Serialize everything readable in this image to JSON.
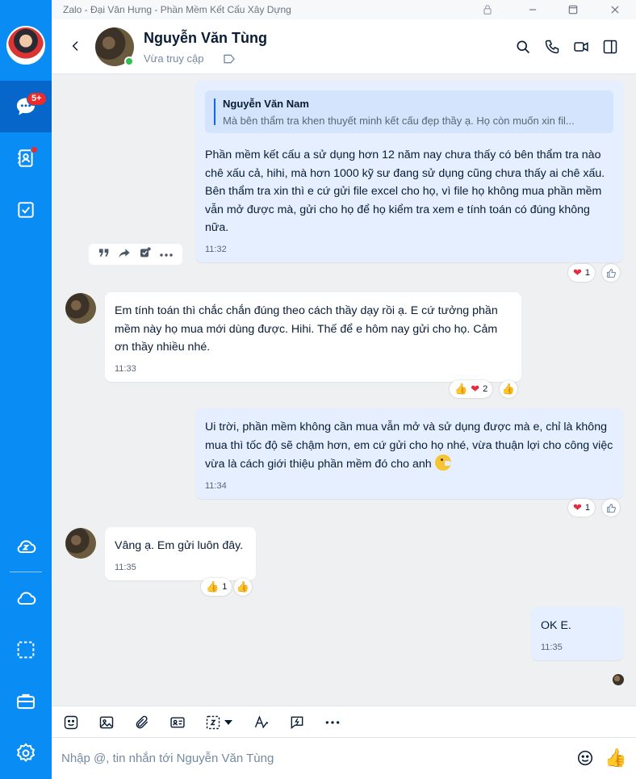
{
  "window": {
    "title": "Zalo - Đại Văn Hưng - Phần Mềm Kết Cấu Xây Dựng"
  },
  "sidebar": {
    "chat_badge": "5+",
    "items": [
      "message-icon",
      "contacts-icon",
      "todo-icon",
      "zcloud-icon",
      "cloud-icon",
      "screenshot-icon",
      "briefcase-icon",
      "settings-icon"
    ]
  },
  "header": {
    "name": "Nguyễn Văn Tùng",
    "status": "Vừa truy cập"
  },
  "messages": [
    {
      "from": "me",
      "quote_name": "Nguyễn Văn Nam",
      "quote_text": "Mà bên thẩm tra khen thuyết minh kết cấu đẹp thầy ạ. Họ còn muốn xin fil...",
      "text": "Phần mềm kết cấu a sử dụng hơn 12 năm nay chưa thấy có bên thẩm tra nào chê xấu cả, hihi, mà hơn 1000 kỹ sư đang sử dụng cũng chưa thấy ai chê xấu. Bên thẩm tra xin thì e cứ gửi file excel cho họ, vì file họ không mua phần mềm vẫn mở được mà, gửi cho họ để họ kiểm tra xem e tính toán có đúng không nữa.",
      "time": "11:32",
      "reaction_count": "1"
    },
    {
      "from": "them",
      "text": "Em tính toán thì chắc chắn đúng theo cách thầy dạy rồi ạ. E cứ tưởng phần mềm này họ mua mới dùng được. Hihi. Thế để e hôm nay gửi cho họ. Cảm ơn thầy nhiều nhé.",
      "time": "11:33",
      "reaction_count": "2"
    },
    {
      "from": "me",
      "text": "Ui trời, phần mềm không cần mua vẫn mở và sử dụng được mà e, chỉ là không mua thì tốc độ sẽ chậm hơn, em cứ gửi cho họ nhé, vừa thuận lợi cho công việc vừa là cách giới thiệu phần mềm đó cho anh",
      "time": "11:34",
      "reaction_count": "1"
    },
    {
      "from": "them",
      "text": "Vâng ạ. Em gửi luôn đây.",
      "time": "11:35",
      "reaction_count": "1"
    },
    {
      "from": "me",
      "text": "OK E.",
      "time": "11:35"
    }
  ],
  "composer": {
    "placeholder": "Nhập @, tin nhắn tới Nguyễn Văn Tùng"
  },
  "colors": {
    "sidebar": "#0a8cf5",
    "sidebar_active": "#0666c9",
    "my_bubble": "#e5efff",
    "their_bubble": "#ffffff",
    "chat_bg": "#eef0f1",
    "accent": "#0a68ff"
  }
}
